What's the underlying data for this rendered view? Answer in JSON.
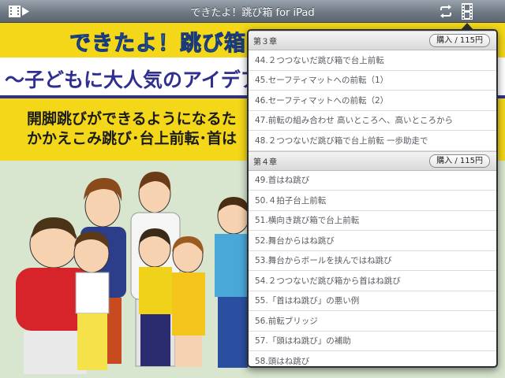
{
  "topbar": {
    "title": "できたよ！跳び箱 for iPad",
    "left_icon": "video-menu-icon",
    "right_icons": [
      "repeat-icon",
      "film-strip-icon"
    ]
  },
  "cover": {
    "headline": "できたよ！跳び箱",
    "subhead": "～子どもに大人気のアイデア技",
    "line1": "開脚跳びができるようになるた",
    "line2": "かかえこみ跳び･台上前転･首は"
  },
  "menu": {
    "sections": [
      {
        "title": "第３章",
        "buy_label": "購入 / 115円",
        "items": [
          "44.２つつないだ跳び箱で台上前転",
          "45.セーフティマットへの前転（1）",
          "46.セーフティマットへの前転（2）",
          "47.前転の組み合わせ 高いところへ、高いところから",
          "48.２つつないだ跳び箱で台上前転 一歩助走で"
        ]
      },
      {
        "title": "第４章",
        "buy_label": "購入 / 115円",
        "items": [
          "49.首はね跳び",
          "50.４拍子台上前転",
          "51.横向き跳び箱で台上前転",
          "52.舞台からはね跳び",
          "53.舞台からボールを挟んではね跳び",
          "54.２つつないだ跳び箱から首はね跳び",
          "55.「首はね跳び」の悪い例",
          "56.前転ブリッジ",
          "57.「頭はね跳び」の補助",
          "58.頭はね跳び"
        ]
      }
    ]
  },
  "colors": {
    "topbar": "#6d7781",
    "cover_yellow": "#f3d718",
    "cover_green": "#d9e6cf",
    "headline_blue": "#2bb6df",
    "subhead_navy": "#2f2f8f"
  }
}
